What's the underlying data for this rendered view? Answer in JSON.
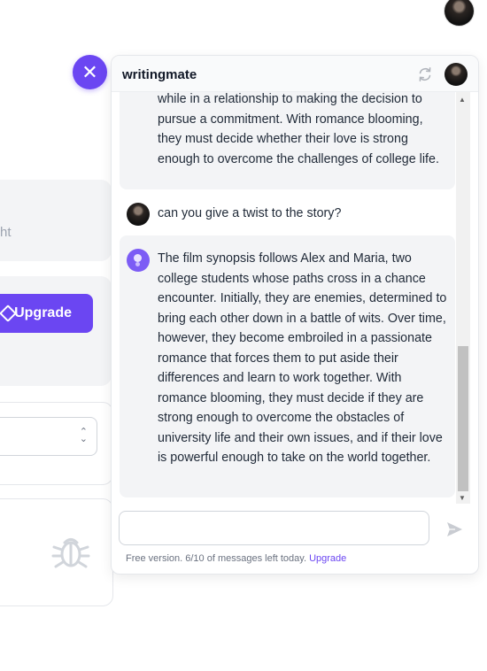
{
  "background_page": {
    "card_partial_text": "ht",
    "upgrade_label": "Upgrade"
  },
  "widget": {
    "brand": "writingmate",
    "close_icon": "close-icon",
    "refresh_icon": "refresh-icon",
    "messages": [
      {
        "role": "assistant",
        "text": "while in a relationship to making the decision to pursue a commitment. With romance blooming, they must decide whether their love is strong enough to overcome the challenges of college life."
      },
      {
        "role": "user",
        "text": "can you give a twist to the story?"
      },
      {
        "role": "assistant",
        "text": "The film synopsis follows Alex and Maria, two college students whose paths cross in a chance encounter. Initially, they are enemies, determined to bring each other down in a battle of wits. Over time, however, they become embroiled in a passionate romance that forces them to put aside their differences and learn to work together. With romance blooming, they must decide if they are strong enough to overcome the obstacles of university life and their own issues, and if their love is powerful enough to take on the world together."
      }
    ],
    "composer_placeholder": "",
    "footnote": "Free version. 6/10 of messages left today.",
    "footnote_link": "Upgrade"
  },
  "colors": {
    "accent": "#6b46f2",
    "assistant_bubble": "#f3f4f6"
  }
}
